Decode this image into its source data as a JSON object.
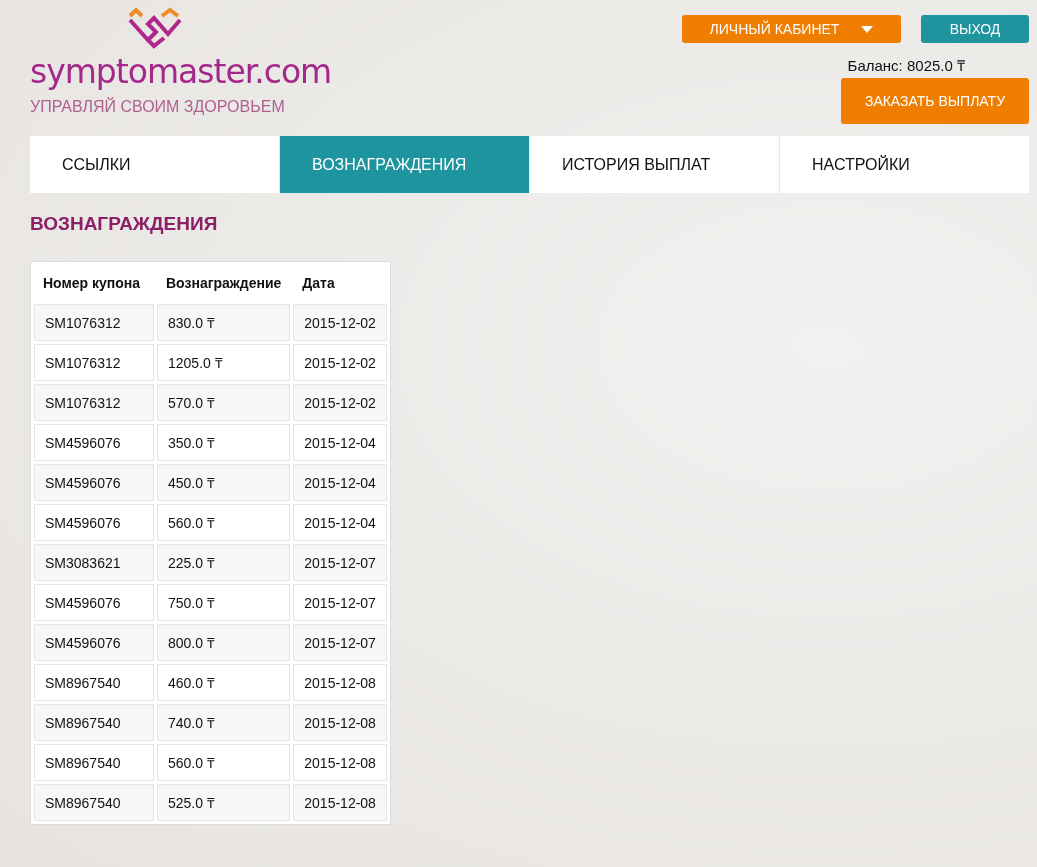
{
  "logo": {
    "text": "symptomaster.com",
    "tagline": "УПРАВЛЯЙ СВОИМ ЗДОРОВЬЕМ"
  },
  "account_menu": {
    "label": "ЛИЧНЫЙ КАБИНЕТ"
  },
  "logout": {
    "label": "ВЫХОД"
  },
  "balance": "Баланс: 8025.0 ₸",
  "payout_button": {
    "label": "ЗАКАЗАТЬ ВЫПЛАТУ"
  },
  "tabs": [
    {
      "label": "ССЫЛКИ",
      "selected": false
    },
    {
      "label": "ВОЗНАГРАЖДЕНИЯ",
      "selected": true
    },
    {
      "label": "ИСТОРИЯ ВЫПЛАТ",
      "selected": false
    },
    {
      "label": "НАСТРОЙКИ",
      "selected": false
    }
  ],
  "heading": "ВОЗНАГРАЖДЕНИЯ",
  "table": {
    "columns": [
      "Номер купона",
      "Вознаграждение",
      "Дата"
    ],
    "rows": [
      [
        "SM1076312",
        "830.0 ₸",
        "2015-12-02"
      ],
      [
        "SM1076312",
        "1205.0 ₸",
        "2015-12-02"
      ],
      [
        "SM1076312",
        "570.0 ₸",
        "2015-12-02"
      ],
      [
        "SM4596076",
        "350.0 ₸",
        "2015-12-04"
      ],
      [
        "SM4596076",
        "450.0 ₸",
        "2015-12-04"
      ],
      [
        "SM4596076",
        "560.0 ₸",
        "2015-12-04"
      ],
      [
        "SM3083621",
        "225.0 ₸",
        "2015-12-07"
      ],
      [
        "SM4596076",
        "750.0 ₸",
        "2015-12-07"
      ],
      [
        "SM4596076",
        "800.0 ₸",
        "2015-12-07"
      ],
      [
        "SM8967540",
        "460.0 ₸",
        "2015-12-08"
      ],
      [
        "SM8967540",
        "740.0 ₸",
        "2015-12-08"
      ],
      [
        "SM8967540",
        "560.0 ₸",
        "2015-12-08"
      ],
      [
        "SM8967540",
        "525.0 ₸",
        "2015-12-08"
      ]
    ]
  }
}
